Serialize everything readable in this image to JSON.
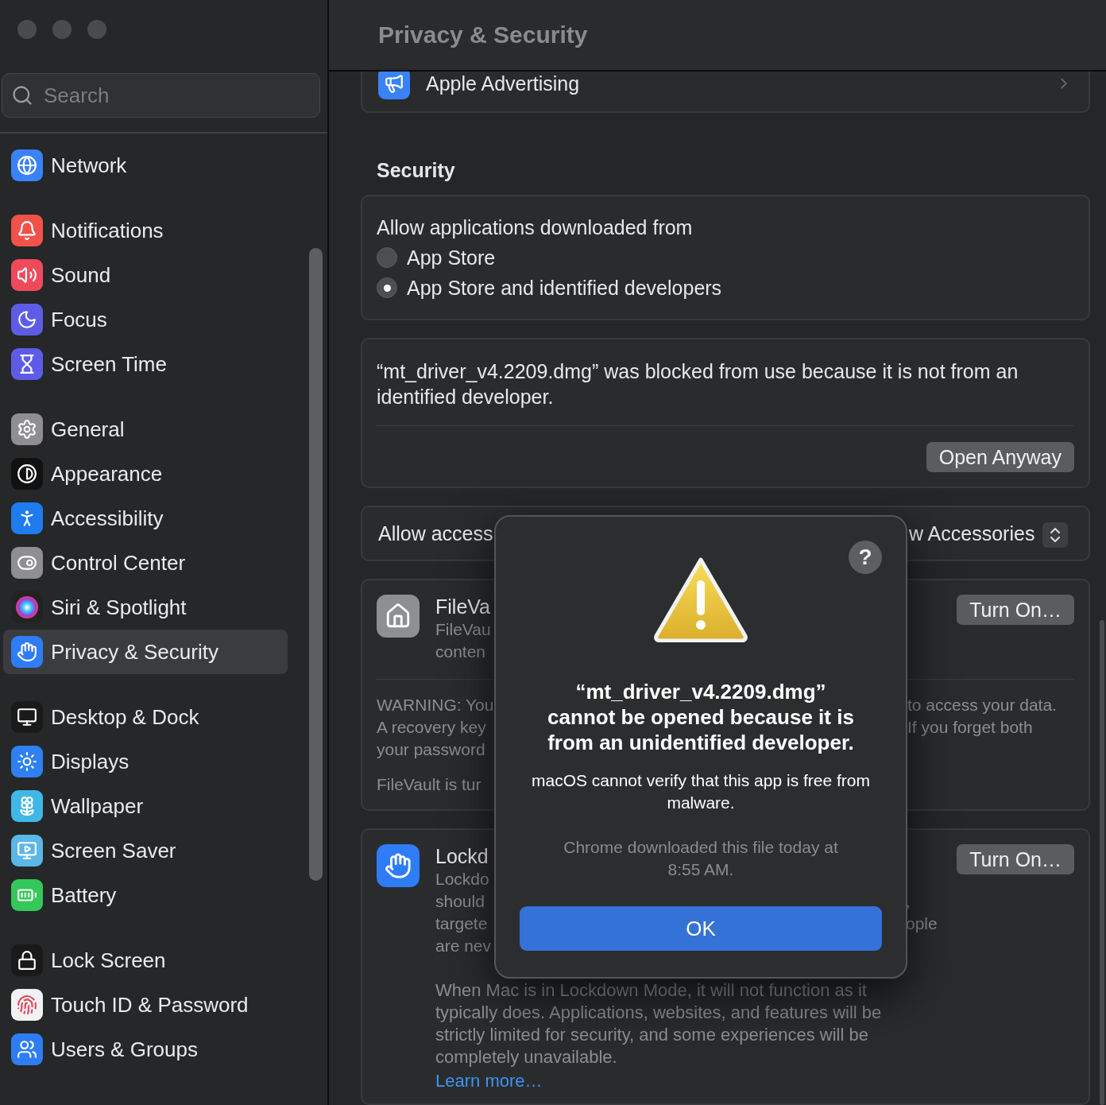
{
  "sidebar": {
    "search": {
      "placeholder": "Search"
    },
    "groups": [
      {
        "items": [
          {
            "label": "Network",
            "kind": "network",
            "selected": false
          }
        ]
      },
      {
        "items": [
          {
            "label": "Notifications",
            "kind": "notifications",
            "selected": false
          },
          {
            "label": "Sound",
            "kind": "sound",
            "selected": false
          },
          {
            "label": "Focus",
            "kind": "focus",
            "selected": false
          },
          {
            "label": "Screen Time",
            "kind": "screentime",
            "selected": false
          }
        ]
      },
      {
        "items": [
          {
            "label": "General",
            "kind": "general",
            "selected": false
          },
          {
            "label": "Appearance",
            "kind": "appearance",
            "selected": false
          },
          {
            "label": "Accessibility",
            "kind": "accessibility",
            "selected": false
          },
          {
            "label": "Control Center",
            "kind": "control",
            "selected": false
          },
          {
            "label": "Siri & Spotlight",
            "kind": "siri",
            "selected": false
          },
          {
            "label": "Privacy & Security",
            "kind": "privacy",
            "selected": true
          }
        ]
      },
      {
        "items": [
          {
            "label": "Desktop & Dock",
            "kind": "dock",
            "selected": false
          },
          {
            "label": "Displays",
            "kind": "displays",
            "selected": false
          },
          {
            "label": "Wallpaper",
            "kind": "wallpaper",
            "selected": false
          },
          {
            "label": "Screen Saver",
            "kind": "screensaver",
            "selected": false
          },
          {
            "label": "Battery",
            "kind": "battery",
            "selected": false
          }
        ]
      },
      {
        "items": [
          {
            "label": "Lock Screen",
            "kind": "lock",
            "selected": false
          },
          {
            "label": "Touch ID & Password",
            "kind": "touchid",
            "selected": false
          },
          {
            "label": "Users & Groups",
            "kind": "users",
            "selected": false
          }
        ]
      }
    ]
  },
  "main": {
    "title": "Privacy & Security",
    "advertising": {
      "label": "Apple Advertising"
    },
    "security": {
      "heading": "Security",
      "allow_apps": {
        "label": "Allow applications downloaded from",
        "options": [
          {
            "label": "App Store",
            "selected": false
          },
          {
            "label": "App Store and identified developers",
            "selected": true
          }
        ]
      },
      "blocked": {
        "message": "“mt_driver_v4.2209.dmg” was blocked from use because it is not from an identified developer.",
        "button": "Open Anyway"
      },
      "accessories": {
        "label_start": "Allow access",
        "label_end": "w Accessories"
      },
      "filevault": {
        "title": "FileVa",
        "desc_lines": [
          "FileVau",
          "conten"
        ],
        "button": "Turn On…",
        "warning_lines": [
          {
            "start": "WARNING: You",
            "end": "to access your data."
          },
          {
            "start": "A recovery key",
            "end": "If you forget both"
          },
          {
            "start": "your password"
          }
        ],
        "status": "FileVault is tur"
      },
      "lockdown": {
        "title": "Lockd",
        "desc_lines": [
          {
            "start": "Lockdo"
          },
          {
            "start": "should",
            "end": ","
          },
          {
            "start": "targete",
            "end": "ople"
          },
          {
            "start": "are nev"
          }
        ],
        "button": "Turn On…",
        "paragraph": "When Mac is in Lockdown Mode, it will not function as it typically does. Applications, websites, and features will be strictly limited for security, and some experiences will be completely unavailable.",
        "link": "Learn more…"
      }
    }
  },
  "dialog": {
    "help": "?",
    "title": "“mt_driver_v4.2209.dmg” cannot be opened because it is from an unidentified developer.",
    "message": "macOS cannot verify that this app is free from malware.",
    "info": "Chrome downloaded this file today at 8:55 AM.",
    "button": "OK"
  }
}
